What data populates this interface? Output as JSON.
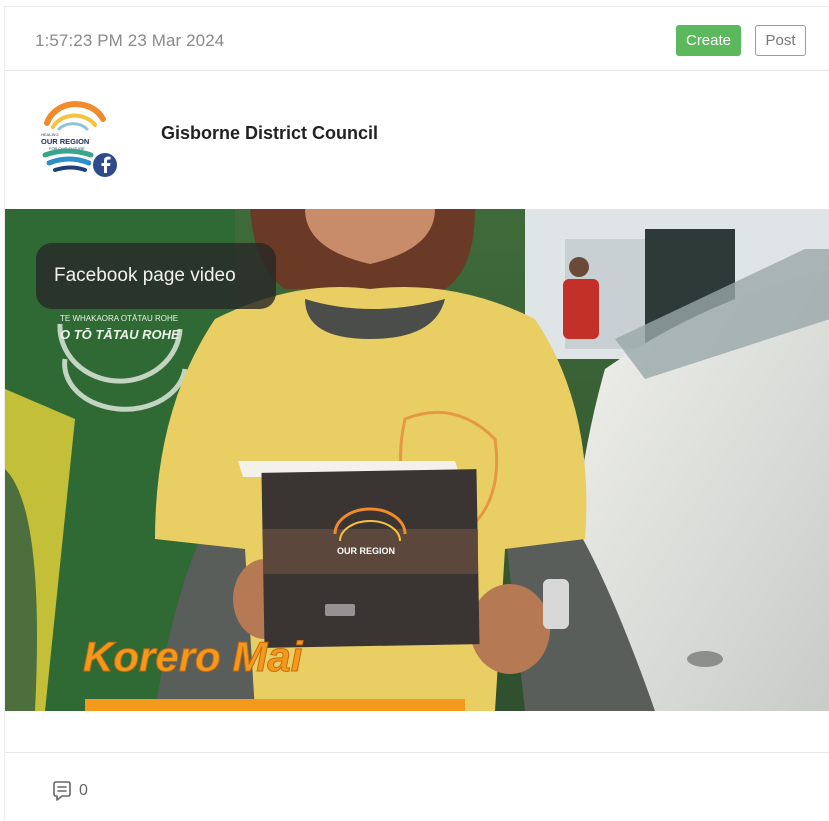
{
  "post": {
    "timestamp": "1:57:23 PM 23 Mar 2024",
    "create_label": "Create",
    "post_label": "Post",
    "author_name": "Gisborne District Council",
    "avatar_text": [
      "HEALING",
      "OUR REGION",
      "FOR OUR FUTURE"
    ],
    "media": {
      "badge": "Facebook page video",
      "overlay_line1": "Korero Mai",
      "banner_text_1": "TE WHAKAORA OTĀTAU ROHE",
      "banner_text_2": "O TŌ TĀTAU ROHE",
      "booklet_title": "OUR REGION"
    },
    "comment_count": "0"
  },
  "colors": {
    "create_button": "#5cb85c",
    "shirt": "#e9cf63",
    "overlay_text": "#f39a1c",
    "facebook": "#1877f2"
  },
  "icons": [
    "facebook-icon",
    "comment-icon"
  ]
}
